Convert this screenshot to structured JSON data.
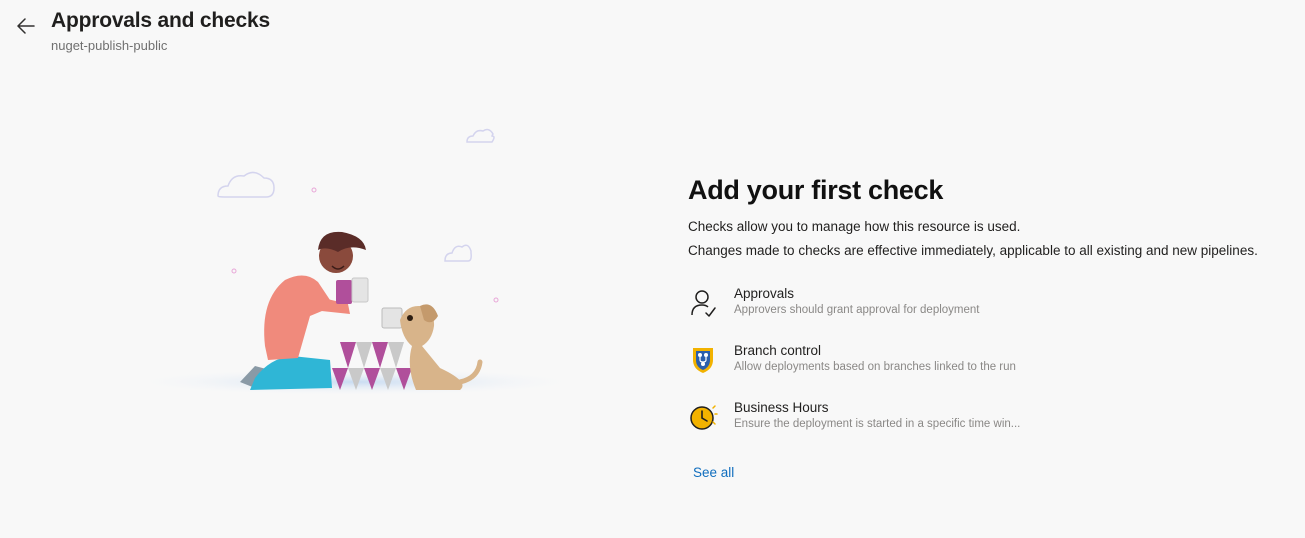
{
  "header": {
    "title": "Approvals and checks",
    "subtitle": "nuget-publish-public",
    "back_icon": "arrow-left-icon"
  },
  "panel": {
    "heading": "Add your first check",
    "description_1": "Checks allow you to manage how this resource is used.",
    "description_2": "Changes made to checks are effective immediately, applicable to all existing and new pipelines.",
    "checks": [
      {
        "name": "Approvals",
        "description": "Approvers should grant approval for deployment",
        "icon": "person-check-icon"
      },
      {
        "name": "Branch control",
        "description": "Allow deployments based on branches linked to the run",
        "icon": "branch-shield-icon"
      },
      {
        "name": "Business Hours",
        "description": "Ensure the deployment is started in a specific time win...",
        "icon": "clock-icon"
      }
    ],
    "see_all": "See all"
  },
  "colors": {
    "background": "#f8f8f8",
    "link": "#106ebe",
    "muted_text": "#8a8886",
    "shield_yellow": "#f2b200",
    "shield_blue": "#2b5fad",
    "clock_yellow": "#f2b200"
  }
}
